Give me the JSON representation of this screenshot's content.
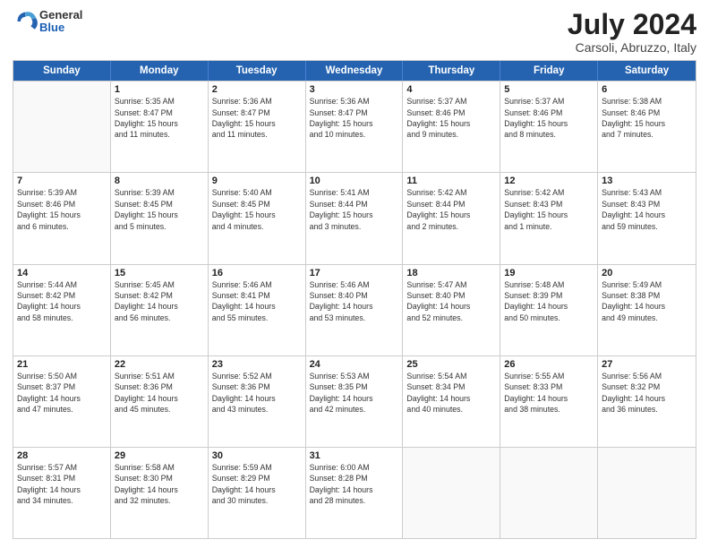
{
  "header": {
    "logo": {
      "general": "General",
      "blue": "Blue"
    },
    "title": "July 2024",
    "location": "Carsoli, Abruzzo, Italy"
  },
  "days_of_week": [
    "Sunday",
    "Monday",
    "Tuesday",
    "Wednesday",
    "Thursday",
    "Friday",
    "Saturday"
  ],
  "weeks": [
    [
      {
        "day": "",
        "lines": []
      },
      {
        "day": "1",
        "lines": [
          "Sunrise: 5:35 AM",
          "Sunset: 8:47 PM",
          "Daylight: 15 hours",
          "and 11 minutes."
        ]
      },
      {
        "day": "2",
        "lines": [
          "Sunrise: 5:36 AM",
          "Sunset: 8:47 PM",
          "Daylight: 15 hours",
          "and 11 minutes."
        ]
      },
      {
        "day": "3",
        "lines": [
          "Sunrise: 5:36 AM",
          "Sunset: 8:47 PM",
          "Daylight: 15 hours",
          "and 10 minutes."
        ]
      },
      {
        "day": "4",
        "lines": [
          "Sunrise: 5:37 AM",
          "Sunset: 8:46 PM",
          "Daylight: 15 hours",
          "and 9 minutes."
        ]
      },
      {
        "day": "5",
        "lines": [
          "Sunrise: 5:37 AM",
          "Sunset: 8:46 PM",
          "Daylight: 15 hours",
          "and 8 minutes."
        ]
      },
      {
        "day": "6",
        "lines": [
          "Sunrise: 5:38 AM",
          "Sunset: 8:46 PM",
          "Daylight: 15 hours",
          "and 7 minutes."
        ]
      }
    ],
    [
      {
        "day": "7",
        "lines": [
          "Sunrise: 5:39 AM",
          "Sunset: 8:46 PM",
          "Daylight: 15 hours",
          "and 6 minutes."
        ]
      },
      {
        "day": "8",
        "lines": [
          "Sunrise: 5:39 AM",
          "Sunset: 8:45 PM",
          "Daylight: 15 hours",
          "and 5 minutes."
        ]
      },
      {
        "day": "9",
        "lines": [
          "Sunrise: 5:40 AM",
          "Sunset: 8:45 PM",
          "Daylight: 15 hours",
          "and 4 minutes."
        ]
      },
      {
        "day": "10",
        "lines": [
          "Sunrise: 5:41 AM",
          "Sunset: 8:44 PM",
          "Daylight: 15 hours",
          "and 3 minutes."
        ]
      },
      {
        "day": "11",
        "lines": [
          "Sunrise: 5:42 AM",
          "Sunset: 8:44 PM",
          "Daylight: 15 hours",
          "and 2 minutes."
        ]
      },
      {
        "day": "12",
        "lines": [
          "Sunrise: 5:42 AM",
          "Sunset: 8:43 PM",
          "Daylight: 15 hours",
          "and 1 minute."
        ]
      },
      {
        "day": "13",
        "lines": [
          "Sunrise: 5:43 AM",
          "Sunset: 8:43 PM",
          "Daylight: 14 hours",
          "and 59 minutes."
        ]
      }
    ],
    [
      {
        "day": "14",
        "lines": [
          "Sunrise: 5:44 AM",
          "Sunset: 8:42 PM",
          "Daylight: 14 hours",
          "and 58 minutes."
        ]
      },
      {
        "day": "15",
        "lines": [
          "Sunrise: 5:45 AM",
          "Sunset: 8:42 PM",
          "Daylight: 14 hours",
          "and 56 minutes."
        ]
      },
      {
        "day": "16",
        "lines": [
          "Sunrise: 5:46 AM",
          "Sunset: 8:41 PM",
          "Daylight: 14 hours",
          "and 55 minutes."
        ]
      },
      {
        "day": "17",
        "lines": [
          "Sunrise: 5:46 AM",
          "Sunset: 8:40 PM",
          "Daylight: 14 hours",
          "and 53 minutes."
        ]
      },
      {
        "day": "18",
        "lines": [
          "Sunrise: 5:47 AM",
          "Sunset: 8:40 PM",
          "Daylight: 14 hours",
          "and 52 minutes."
        ]
      },
      {
        "day": "19",
        "lines": [
          "Sunrise: 5:48 AM",
          "Sunset: 8:39 PM",
          "Daylight: 14 hours",
          "and 50 minutes."
        ]
      },
      {
        "day": "20",
        "lines": [
          "Sunrise: 5:49 AM",
          "Sunset: 8:38 PM",
          "Daylight: 14 hours",
          "and 49 minutes."
        ]
      }
    ],
    [
      {
        "day": "21",
        "lines": [
          "Sunrise: 5:50 AM",
          "Sunset: 8:37 PM",
          "Daylight: 14 hours",
          "and 47 minutes."
        ]
      },
      {
        "day": "22",
        "lines": [
          "Sunrise: 5:51 AM",
          "Sunset: 8:36 PM",
          "Daylight: 14 hours",
          "and 45 minutes."
        ]
      },
      {
        "day": "23",
        "lines": [
          "Sunrise: 5:52 AM",
          "Sunset: 8:36 PM",
          "Daylight: 14 hours",
          "and 43 minutes."
        ]
      },
      {
        "day": "24",
        "lines": [
          "Sunrise: 5:53 AM",
          "Sunset: 8:35 PM",
          "Daylight: 14 hours",
          "and 42 minutes."
        ]
      },
      {
        "day": "25",
        "lines": [
          "Sunrise: 5:54 AM",
          "Sunset: 8:34 PM",
          "Daylight: 14 hours",
          "and 40 minutes."
        ]
      },
      {
        "day": "26",
        "lines": [
          "Sunrise: 5:55 AM",
          "Sunset: 8:33 PM",
          "Daylight: 14 hours",
          "and 38 minutes."
        ]
      },
      {
        "day": "27",
        "lines": [
          "Sunrise: 5:56 AM",
          "Sunset: 8:32 PM",
          "Daylight: 14 hours",
          "and 36 minutes."
        ]
      }
    ],
    [
      {
        "day": "28",
        "lines": [
          "Sunrise: 5:57 AM",
          "Sunset: 8:31 PM",
          "Daylight: 14 hours",
          "and 34 minutes."
        ]
      },
      {
        "day": "29",
        "lines": [
          "Sunrise: 5:58 AM",
          "Sunset: 8:30 PM",
          "Daylight: 14 hours",
          "and 32 minutes."
        ]
      },
      {
        "day": "30",
        "lines": [
          "Sunrise: 5:59 AM",
          "Sunset: 8:29 PM",
          "Daylight: 14 hours",
          "and 30 minutes."
        ]
      },
      {
        "day": "31",
        "lines": [
          "Sunrise: 6:00 AM",
          "Sunset: 8:28 PM",
          "Daylight: 14 hours",
          "and 28 minutes."
        ]
      },
      {
        "day": "",
        "lines": []
      },
      {
        "day": "",
        "lines": []
      },
      {
        "day": "",
        "lines": []
      }
    ]
  ]
}
